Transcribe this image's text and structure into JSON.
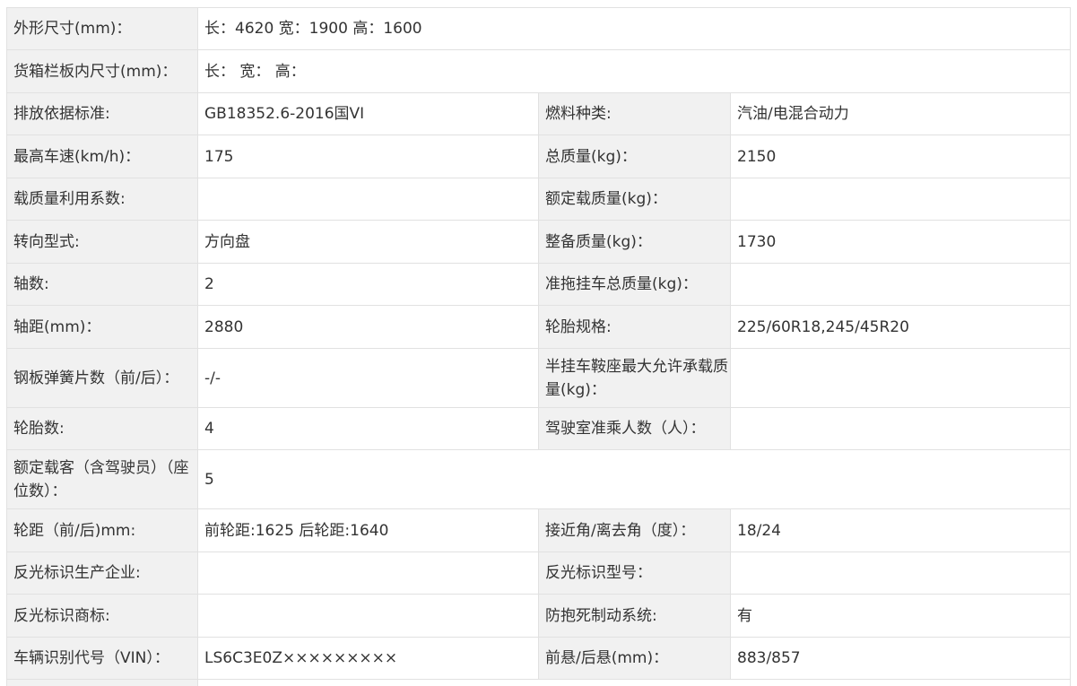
{
  "spec": {
    "outer_size_label": "外形尺寸(mm)：",
    "outer_size_value": "长：4620 宽：1900 高：1600",
    "cargo_size_label": "货箱栏板内尺寸(mm)：",
    "cargo_size_value": "长： 宽： 高：",
    "emission_label": "排放依据标准:",
    "emission_value": "GB18352.6-2016国VI",
    "fuel_label": "燃料种类:",
    "fuel_value": "汽油/电混合动力",
    "max_speed_label": "最高车速(km/h)：",
    "max_speed_value": "175",
    "total_mass_label": "总质量(kg)：",
    "total_mass_value": "2150",
    "load_factor_label": "载质量利用系数:",
    "load_factor_value": "",
    "rated_load_label": "额定载质量(kg)：",
    "rated_load_value": "",
    "steering_label": "转向型式:",
    "steering_value": "方向盘",
    "curb_mass_label": "整备质量(kg)：",
    "curb_mass_value": "1730",
    "axles_label": "轴数:",
    "axles_value": "2",
    "trailer_mass_label": "准拖挂车总质量(kg)：",
    "trailer_mass_value": "",
    "wheelbase_label": "轴距(mm)：",
    "wheelbase_value": "2880",
    "tire_spec_label": "轮胎规格:",
    "tire_spec_value": "225/60R18,245/45R20",
    "leaf_spring_label": "钢板弹簧片数（前/后）：",
    "leaf_spring_value": "-/-",
    "saddle_load_label": "半挂车鞍座最大允许承载质量(kg)：",
    "saddle_load_value": "",
    "tire_count_label": "轮胎数:",
    "tire_count_value": "4",
    "cab_passengers_label": "驾驶室准乘人数（人）：",
    "cab_passengers_value": "",
    "passengers_label": "额定载客（含驾驶员）（座位数）：",
    "passengers_value": "5",
    "track_label": "轮距（前/后)mm:",
    "track_value": "前轮距:1625 后轮距:1640",
    "angle_label": "接近角/离去角（度）：",
    "angle_value": "18/24",
    "reflector_maker_label": "反光标识生产企业:",
    "reflector_maker_value": "",
    "reflector_model_label": "反光标识型号：",
    "reflector_model_value": "",
    "reflector_brand_label": "反光标识商标:",
    "reflector_brand_value": "",
    "abs_label": "防抱死制动系统:",
    "abs_value": "有",
    "vin_label": "车辆识别代号（VIN）：",
    "vin_value": "LS6C3E0Z×××××××××",
    "overhang_label": "前悬/后悬(mm)：",
    "overhang_value": "883/857"
  }
}
